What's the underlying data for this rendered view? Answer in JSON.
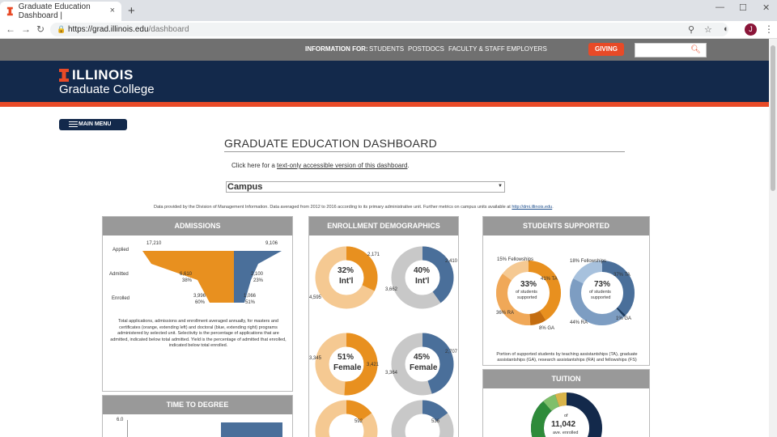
{
  "browser": {
    "tab_title": "Graduate Education Dashboard |",
    "tab_close": "×",
    "new_tab": "+",
    "url_host": "https://grad.illinois.edu",
    "url_path": "/dashboard",
    "avatar_letter": "J"
  },
  "topnav": {
    "label": "INFORMATION FOR:",
    "links": [
      "STUDENTS",
      "POSTDOCS",
      "FACULTY & STAFF",
      "EMPLOYERS"
    ],
    "giving": "GIVING"
  },
  "brand": {
    "line1": "ILLINOIS",
    "line2": "Graduate College",
    "colors": {
      "navy": "#13294b",
      "orange": "#e84a27"
    }
  },
  "main": {
    "menu_button": "MAIN MENU",
    "title": "GRADUATE EDUCATION DASHBOARD",
    "textonly_prefix": "Click here for a ",
    "textonly_link": "text-only accessible version of this dashboard",
    "textonly_suffix": ".",
    "unit_select": "Campus",
    "provided_text": "Data provided by the Division of Management Information. Data averaged from 2012 to 2016 according to its primary administrative unit. Further metrics on campus units available at ",
    "provided_link": "http://dmi.illinois.edu",
    "provided_suffix": "."
  },
  "admissions": {
    "title": "ADMISSIONS",
    "rows": [
      "Applied",
      "Admitted",
      "Enrolled"
    ],
    "masters": {
      "applied": "17,210",
      "admitted": "6,610",
      "admitted_pct": "38%",
      "enrolled": "3,996",
      "enrolled_pct": "60%"
    },
    "doctoral": {
      "applied": "9,106",
      "admitted": "2,100",
      "admitted_pct": "23%",
      "enrolled": "1,066",
      "enrolled_pct": "51%"
    },
    "note": "Total applications, admissions and enrollment averaged annually, for masters and certificates (orange, extending left) and doctoral (blue, extending right) programs administered by selected unit. Selectivity is the percentage of applications that are admitted, indicated below total admitted. Yield is the percentage of admitted that enrolled, indicated below total enrolled."
  },
  "enrollment": {
    "title": "ENROLLMENT DEMOGRAPHICS",
    "donuts": [
      {
        "pct": "32%",
        "label": "Int'l",
        "a": "2,171",
        "b": "4,595",
        "frac": 0.32,
        "color": "#e8901f",
        "rest": "#f5c992"
      },
      {
        "pct": "40%",
        "label": "Int'l",
        "a": "2,410",
        "b": "3,662",
        "frac": 0.4,
        "color": "#4a6f9a",
        "rest": "#c8c8c8"
      },
      {
        "pct": "51%",
        "label": "Female",
        "a": "3,421",
        "b": "3,345",
        "frac": 0.51,
        "color": "#e8901f",
        "rest": "#f5c992"
      },
      {
        "pct": "45%",
        "label": "Female",
        "a": "2,707",
        "b": "3,364",
        "frac": 0.45,
        "color": "#4a6f9a",
        "rest": "#c8c8c8"
      }
    ],
    "partial": [
      "592",
      "536"
    ]
  },
  "supported": {
    "title": "STUDENTS SUPPORTED",
    "left": {
      "pct": "33%",
      "sub1": "of students",
      "sub2": "supported",
      "fellow": "15% Fellowships",
      "ta": "41% TA",
      "ra": "36% RA",
      "ga": "8% GA"
    },
    "right": {
      "pct": "73%",
      "sub1": "of students",
      "sub2": "supported",
      "fellow": "18% Fellowships",
      "ta": "37% TA",
      "ra": "44% RA",
      "ga": "1% GA"
    },
    "note": "Portion of supported students by teaching assistantships (TA), graduate assistantships (GA), research assistantships (RA) and fellowships (FS)"
  },
  "time_to_degree": {
    "title": "TIME TO DEGREE",
    "ytick": "6.0"
  },
  "tuition": {
    "title": "TUITION",
    "of": "of",
    "value": "11,042",
    "sub": "ave. enrolled"
  }
}
